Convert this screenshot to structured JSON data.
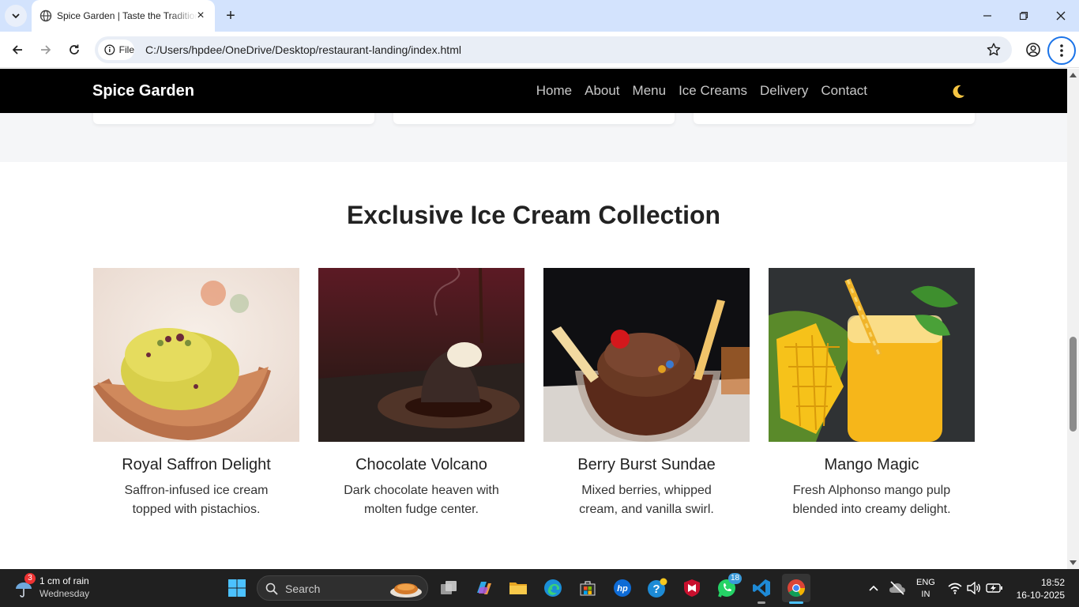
{
  "browser": {
    "tab_title": "Spice Garden | Taste the Tradition",
    "new_tab_symbol": "+",
    "close_symbol": "×",
    "address_chip": "File",
    "url": "C:/Users/hpdee/OneDrive/Desktop/restaurant-landing/index.html"
  },
  "site": {
    "brand": "Spice Garden",
    "nav": [
      "Home",
      "About",
      "Menu",
      "Ice Creams",
      "Delivery",
      "Contact"
    ],
    "theme_toggle_icon": "moon-icon"
  },
  "collection": {
    "title": "Exclusive Ice Cream Collection",
    "items": [
      {
        "name": "Royal Saffron Delight",
        "desc": "Saffron-infused ice cream topped with pistachios."
      },
      {
        "name": "Chocolate Volcano",
        "desc": "Dark chocolate heaven with molten fudge center."
      },
      {
        "name": "Berry Burst Sundae",
        "desc": "Mixed berries, whipped cream, and vanilla swirl."
      },
      {
        "name": "Mango Magic",
        "desc": "Fresh Alphonso mango pulp blended into creamy delight."
      }
    ]
  },
  "taskbar": {
    "weather_badge": "3",
    "weather_line1": "1 cm of rain",
    "weather_line2": "Wednesday",
    "search_placeholder": "Search",
    "whatsapp_badge": "18",
    "lang_line1": "ENG",
    "lang_line2": "IN",
    "time": "18:52",
    "date": "16-10-2025"
  },
  "colors": {
    "site_nav_bg": "#000000",
    "tabbar_bg": "#d3e3fd",
    "taskbar_bg": "#202020"
  }
}
